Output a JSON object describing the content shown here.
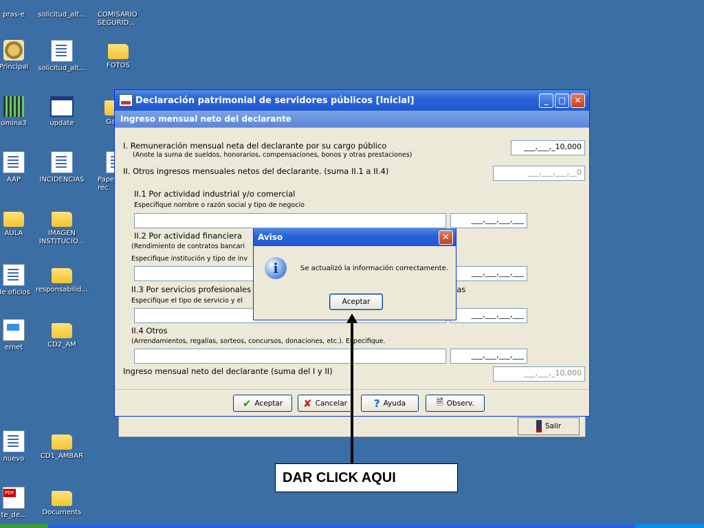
{
  "desktop": {
    "icons": [
      {
        "label": "pras-e",
        "kind": "doc"
      },
      {
        "label": "solicitud_alt...",
        "kind": "doc"
      },
      {
        "label": "COMISARIO SEGURID...",
        "kind": "doc"
      },
      {
        "label": "Principal",
        "kind": "seal"
      },
      {
        "label": "solicitud_alt...",
        "kind": "doc"
      },
      {
        "label": "FOTOS",
        "kind": "folder"
      },
      {
        "label": "omina3",
        "kind": "grid"
      },
      {
        "label": "update",
        "kind": "win"
      },
      {
        "label": "Ga",
        "kind": "folder"
      },
      {
        "label": "AAP",
        "kind": "doc"
      },
      {
        "label": "INCIDENCIAS",
        "kind": "doc"
      },
      {
        "label": "Pape rec",
        "kind": "doc"
      },
      {
        "label": "AULA",
        "kind": "folder"
      },
      {
        "label": "IMAGEN INSTITUCIO...",
        "kind": "folder"
      },
      {
        "label": "de oficios",
        "kind": "doc"
      },
      {
        "label": "responsabilid...",
        "kind": "folder"
      },
      {
        "label": "ernet",
        "kind": "net"
      },
      {
        "label": "CD2_AM",
        "kind": "folder"
      },
      {
        "label": "nuevo",
        "kind": "doc"
      },
      {
        "label": "CD1_AMBAR",
        "kind": "folder"
      },
      {
        "label": "te_de...",
        "kind": "pdf"
      },
      {
        "label": "Documents",
        "kind": "folder"
      }
    ]
  },
  "window": {
    "title": "Declaración patrimonial de servidores públicos [Inicial]",
    "subtitle": "Ingreso mensual neto del declarante",
    "minimize": "_",
    "maximize": "□",
    "close": "✕"
  },
  "form": {
    "s1_label": "I. Remuneración mensual neta del declarante por su cargo público",
    "s1_hint": "(Anote la suma de sueldos, honorarios, compensaciones, bonos y otras prestaciones)",
    "s1_value": "___,___,_10,000",
    "s2_label": "II. Otros ingresos mensuales netos del declarante. (suma II.1 a II.4)",
    "s2_value": "___,___,___,__0",
    "s21_label": "II.1 Por actividad industrial y/o comercial",
    "s21_hint": "Especifique nombre o razón social y tipo de negocio",
    "s22_label": "II.2 Por actividad financiera",
    "s22_hint": "(Rendimiento de contratos bancari",
    "s22_hint2": "Especifique institución y tipo de inv",
    "s23_label": "II.3 Por servicios profesionales",
    "s23_tail": "ías",
    "s23_hint": "Especifique el tipo de servicio y el",
    "s24_label": "II.4 Otros",
    "s24_hint": "(Arrendamientos, regalías, sorteos, concursos, donaciones, etc.). Especifique.",
    "money_blank": "___,___,___,___",
    "total_label": "Ingreso mensual neto del declarante (suma del I y II)",
    "total_value": "___,___,_10,000"
  },
  "buttons": {
    "aceptar": "Aceptar",
    "cancelar": "Cancelar",
    "ayuda": "Ayuda",
    "observ": "Observ.",
    "salir": "Salir"
  },
  "dialog": {
    "title": "Aviso",
    "message": "Se actualizó la información correctamente.",
    "ok": "Aceptar",
    "close": "✕",
    "info_glyph": "i"
  },
  "annotation": {
    "text": "DAR CLICK AQUI"
  }
}
